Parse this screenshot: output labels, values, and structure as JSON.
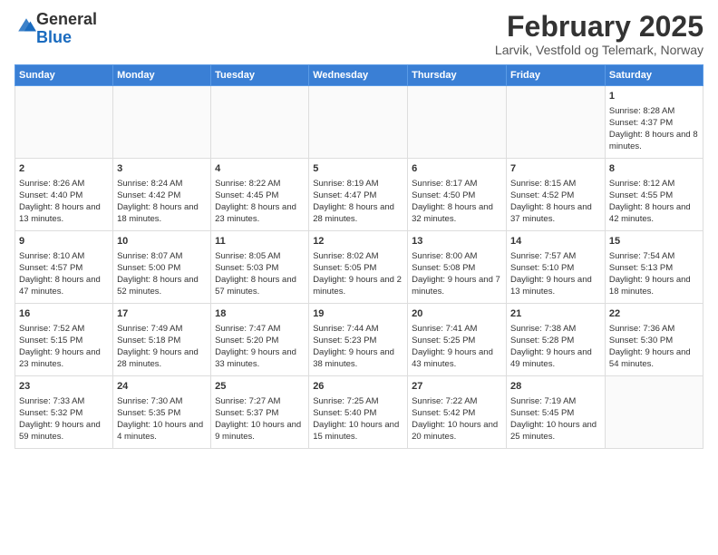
{
  "logo": {
    "general": "General",
    "blue": "Blue"
  },
  "header": {
    "month": "February 2025",
    "location": "Larvik, Vestfold og Telemark, Norway"
  },
  "weekdays": [
    "Sunday",
    "Monday",
    "Tuesday",
    "Wednesday",
    "Thursday",
    "Friday",
    "Saturday"
  ],
  "weeks": [
    [
      {
        "day": "",
        "content": ""
      },
      {
        "day": "",
        "content": ""
      },
      {
        "day": "",
        "content": ""
      },
      {
        "day": "",
        "content": ""
      },
      {
        "day": "",
        "content": ""
      },
      {
        "day": "",
        "content": ""
      },
      {
        "day": "1",
        "content": "Sunrise: 8:28 AM\nSunset: 4:37 PM\nDaylight: 8 hours and 8 minutes."
      }
    ],
    [
      {
        "day": "2",
        "content": "Sunrise: 8:26 AM\nSunset: 4:40 PM\nDaylight: 8 hours and 13 minutes."
      },
      {
        "day": "3",
        "content": "Sunrise: 8:24 AM\nSunset: 4:42 PM\nDaylight: 8 hours and 18 minutes."
      },
      {
        "day": "4",
        "content": "Sunrise: 8:22 AM\nSunset: 4:45 PM\nDaylight: 8 hours and 23 minutes."
      },
      {
        "day": "5",
        "content": "Sunrise: 8:19 AM\nSunset: 4:47 PM\nDaylight: 8 hours and 28 minutes."
      },
      {
        "day": "6",
        "content": "Sunrise: 8:17 AM\nSunset: 4:50 PM\nDaylight: 8 hours and 32 minutes."
      },
      {
        "day": "7",
        "content": "Sunrise: 8:15 AM\nSunset: 4:52 PM\nDaylight: 8 hours and 37 minutes."
      },
      {
        "day": "8",
        "content": "Sunrise: 8:12 AM\nSunset: 4:55 PM\nDaylight: 8 hours and 42 minutes."
      }
    ],
    [
      {
        "day": "9",
        "content": "Sunrise: 8:10 AM\nSunset: 4:57 PM\nDaylight: 8 hours and 47 minutes."
      },
      {
        "day": "10",
        "content": "Sunrise: 8:07 AM\nSunset: 5:00 PM\nDaylight: 8 hours and 52 minutes."
      },
      {
        "day": "11",
        "content": "Sunrise: 8:05 AM\nSunset: 5:03 PM\nDaylight: 8 hours and 57 minutes."
      },
      {
        "day": "12",
        "content": "Sunrise: 8:02 AM\nSunset: 5:05 PM\nDaylight: 9 hours and 2 minutes."
      },
      {
        "day": "13",
        "content": "Sunrise: 8:00 AM\nSunset: 5:08 PM\nDaylight: 9 hours and 7 minutes."
      },
      {
        "day": "14",
        "content": "Sunrise: 7:57 AM\nSunset: 5:10 PM\nDaylight: 9 hours and 13 minutes."
      },
      {
        "day": "15",
        "content": "Sunrise: 7:54 AM\nSunset: 5:13 PM\nDaylight: 9 hours and 18 minutes."
      }
    ],
    [
      {
        "day": "16",
        "content": "Sunrise: 7:52 AM\nSunset: 5:15 PM\nDaylight: 9 hours and 23 minutes."
      },
      {
        "day": "17",
        "content": "Sunrise: 7:49 AM\nSunset: 5:18 PM\nDaylight: 9 hours and 28 minutes."
      },
      {
        "day": "18",
        "content": "Sunrise: 7:47 AM\nSunset: 5:20 PM\nDaylight: 9 hours and 33 minutes."
      },
      {
        "day": "19",
        "content": "Sunrise: 7:44 AM\nSunset: 5:23 PM\nDaylight: 9 hours and 38 minutes."
      },
      {
        "day": "20",
        "content": "Sunrise: 7:41 AM\nSunset: 5:25 PM\nDaylight: 9 hours and 43 minutes."
      },
      {
        "day": "21",
        "content": "Sunrise: 7:38 AM\nSunset: 5:28 PM\nDaylight: 9 hours and 49 minutes."
      },
      {
        "day": "22",
        "content": "Sunrise: 7:36 AM\nSunset: 5:30 PM\nDaylight: 9 hours and 54 minutes."
      }
    ],
    [
      {
        "day": "23",
        "content": "Sunrise: 7:33 AM\nSunset: 5:32 PM\nDaylight: 9 hours and 59 minutes."
      },
      {
        "day": "24",
        "content": "Sunrise: 7:30 AM\nSunset: 5:35 PM\nDaylight: 10 hours and 4 minutes."
      },
      {
        "day": "25",
        "content": "Sunrise: 7:27 AM\nSunset: 5:37 PM\nDaylight: 10 hours and 9 minutes."
      },
      {
        "day": "26",
        "content": "Sunrise: 7:25 AM\nSunset: 5:40 PM\nDaylight: 10 hours and 15 minutes."
      },
      {
        "day": "27",
        "content": "Sunrise: 7:22 AM\nSunset: 5:42 PM\nDaylight: 10 hours and 20 minutes."
      },
      {
        "day": "28",
        "content": "Sunrise: 7:19 AM\nSunset: 5:45 PM\nDaylight: 10 hours and 25 minutes."
      },
      {
        "day": "",
        "content": ""
      }
    ]
  ]
}
